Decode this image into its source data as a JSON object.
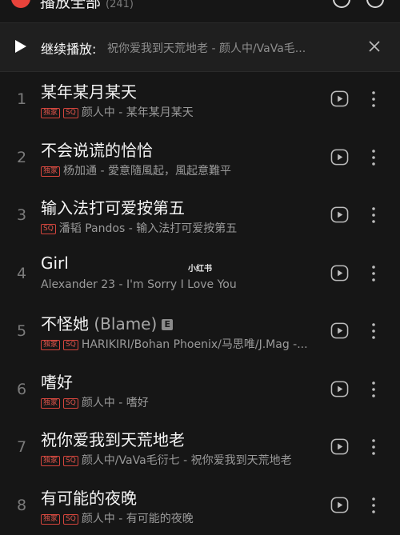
{
  "header": {
    "title": "播放全部",
    "count": "(241)"
  },
  "continue_bar": {
    "label": "继续播放:",
    "track": "祝你爱我到天荒地老 - 颜人中/VaVa毛..."
  },
  "watermark": "小红书",
  "songs": [
    {
      "index": "1",
      "title": "某年某月某天",
      "badges": [
        "独家",
        "SQ"
      ],
      "meta": "颜人中 - 某年某月某天"
    },
    {
      "index": "2",
      "title": "不会说谎的恰恰",
      "badges": [
        "独家"
      ],
      "meta": "杨加通 - 愛意隨風起，風起意難平"
    },
    {
      "index": "3",
      "title": "输入法打可爱按第五",
      "badges": [
        "SQ"
      ],
      "meta": "潘韬 Pandos - 输入法打可爱按第五"
    },
    {
      "index": "4",
      "title": "Girl",
      "badges": [],
      "meta": "Alexander 23 - I'm Sorry I Love You"
    },
    {
      "index": "5",
      "title": "不怪她",
      "subtitle": "(Blame)",
      "explicit": "E",
      "badges": [
        "独家",
        "SQ"
      ],
      "meta": "HARIKIRI/Bohan Phoenix/马思唯/J.Mag -..."
    },
    {
      "index": "6",
      "title": "嗜好",
      "badges": [
        "独家",
        "SQ"
      ],
      "meta": "颜人中 - 嗜好"
    },
    {
      "index": "7",
      "title": "祝你爱我到天荒地老",
      "badges": [
        "独家",
        "SQ"
      ],
      "meta": "颜人中/VaVa毛衍七 - 祝你爱我到天荒地老"
    },
    {
      "index": "8",
      "title": "有可能的夜晚",
      "badges": [
        "独家",
        "SQ"
      ],
      "meta": "颜人中 - 有可能的夜晚"
    }
  ],
  "colors": {
    "background": "#161616",
    "accent": "#e8433b",
    "badge": "#d6453c"
  }
}
